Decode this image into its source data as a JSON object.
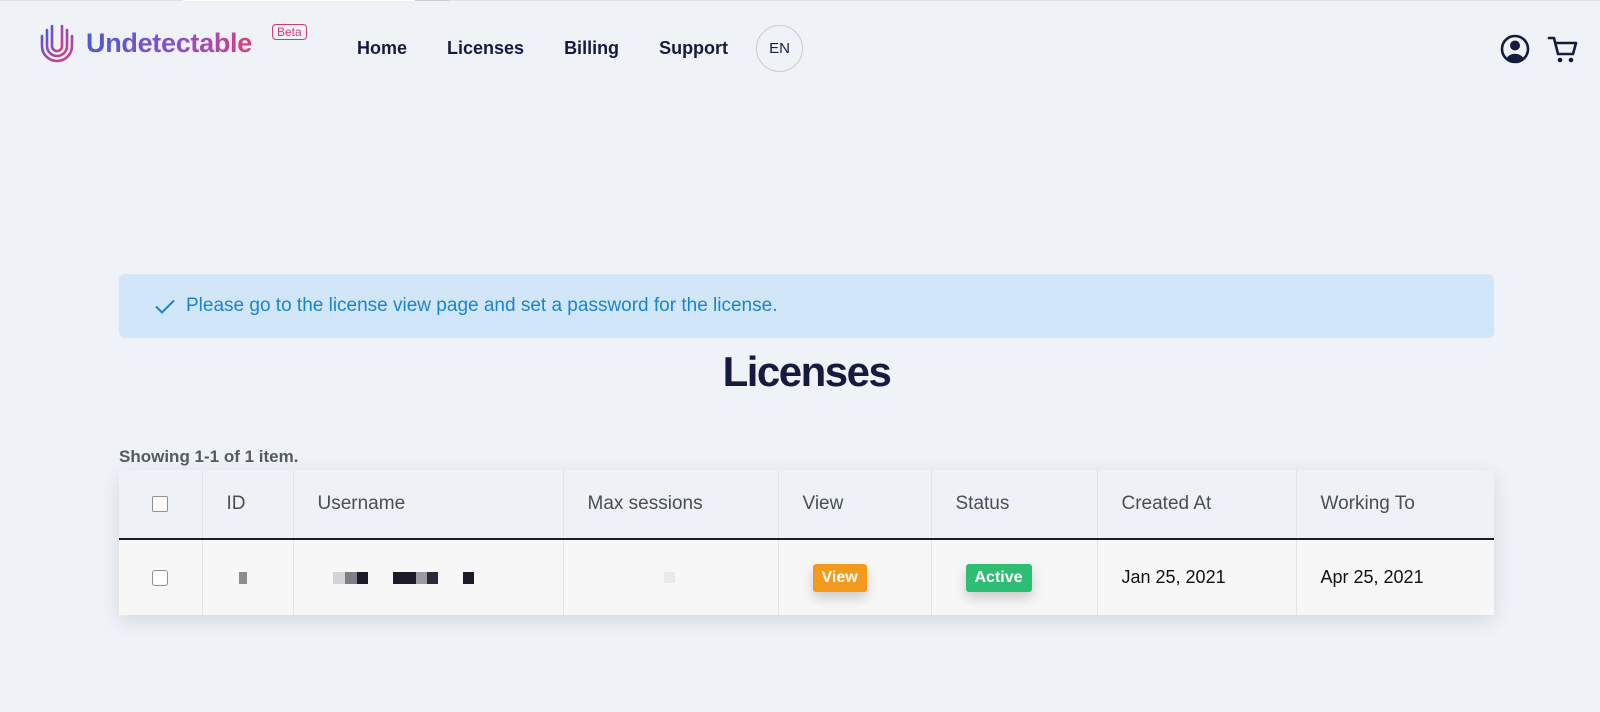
{
  "header": {
    "brand": "Undetectable",
    "badge": "Beta",
    "nav": [
      "Home",
      "Licenses",
      "Billing",
      "Support"
    ],
    "language": "EN",
    "icons": [
      "user-icon",
      "cart-icon"
    ]
  },
  "alert": {
    "icon": "check-icon",
    "message": "Please go to the license view page and set a password for the license."
  },
  "page": {
    "title": "Licenses",
    "summary": "Showing 1-1 of 1 item."
  },
  "table": {
    "columns": [
      "ID",
      "Username",
      "Max sessions",
      "View",
      "Status",
      "Created At",
      "Working To"
    ],
    "rows": [
      {
        "view": "View",
        "status": "Active",
        "created_at": "Jan 25, 2021",
        "working_to": "Apr 25, 2021"
      }
    ]
  },
  "colors": {
    "brand_start": "#4d5ad9",
    "brand_end": "#d6407e",
    "alert_bg": "#d1e6f8",
    "alert_text": "#1a84cf",
    "view_badge": "#f39a1c",
    "active_badge": "#2ebd73"
  }
}
